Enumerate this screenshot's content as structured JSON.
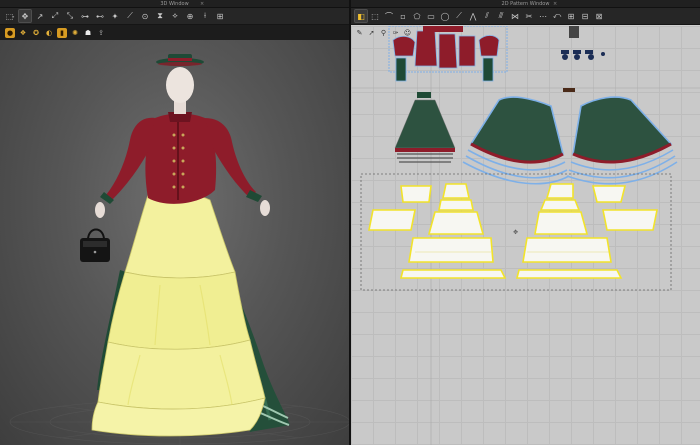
{
  "window3d": {
    "title": "3D Window",
    "close": "×",
    "toolbar_icons": [
      "select-mesh-icon",
      "move-icon",
      "rotate-icon",
      "transform-icon",
      "fold-icon",
      "pin-icon",
      "tack-icon",
      "avatar-icon",
      "measure-icon",
      "button-icon",
      "zip-icon",
      "bone-icon",
      "xray-icon",
      "texture-icon",
      "trim-icon"
    ],
    "toolbar2_icons": [
      "avatar-display-icon",
      "garment-display-icon",
      "pattern-display-icon",
      "texture-display-icon",
      "lighting-icon",
      "skin-icon",
      "fabric-icon",
      "export-icon"
    ]
  },
  "window2d": {
    "title": "2D Pattern Window",
    "close": "×",
    "toolbar_icons": [
      "transform-pattern-icon",
      "edit-pattern-icon",
      "edit-curvature-icon",
      "add-point-icon",
      "polygon-icon",
      "rectangle-icon",
      "circle-icon",
      "internal-line-icon",
      "dart-icon",
      "seam-icon",
      "free-seam-icon",
      "segment-seam-icon",
      "trim-tool-icon",
      "topstitch-icon",
      "fold-tool-icon",
      "arrange-icon",
      "grid-icon",
      "snap-icon"
    ],
    "side_icons": [
      "pen-icon",
      "arrow-icon",
      "pin-tool-icon",
      "needle-icon",
      "avatar-tool-icon"
    ]
  },
  "colors": {
    "jacket": "#8e1c2a",
    "jacket_dark": "#5d0f19",
    "skirt_yellow": "#f3f19e",
    "skirt_green": "#1f4a35",
    "pattern_green": "#2d5240",
    "selection_blue": "#7eb0e8",
    "seam_yellow": "#f2e32b"
  }
}
